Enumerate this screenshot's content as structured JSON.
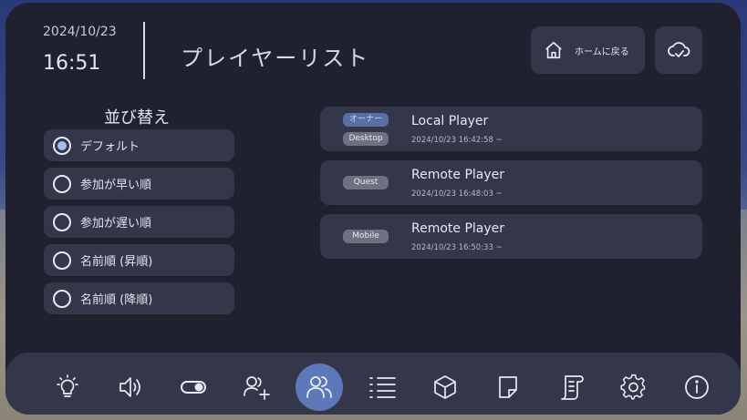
{
  "header": {
    "date": "2024/10/23",
    "time": "16:51",
    "title": "プレイヤーリスト",
    "home_label": "ホームに戻る",
    "home_icon": "home-icon",
    "cloud_icon": "cloud-check-icon"
  },
  "sort": {
    "title": "並び替え",
    "options": [
      {
        "label": "デフォルト",
        "selected": true
      },
      {
        "label": "参加が早い順",
        "selected": false
      },
      {
        "label": "参加が遅い順",
        "selected": false
      },
      {
        "label": "名前順 (昇順)",
        "selected": false
      },
      {
        "label": "名前順 (降順)",
        "selected": false
      }
    ]
  },
  "players": [
    {
      "badges": [
        "オーナー",
        "Desktop"
      ],
      "name": "Local Player",
      "joined": "2024/10/23 16:42:58 ~"
    },
    {
      "badges": [
        "Quest"
      ],
      "name": "Remote Player",
      "joined": "2024/10/23 16:48:03 ~"
    },
    {
      "badges": [
        "Mobile"
      ],
      "name": "Remote Player",
      "joined": "2024/10/23 16:50:33 ~"
    }
  ],
  "dock": {
    "items": [
      "lightbulb-icon",
      "speaker-icon",
      "toggle-icon",
      "add-user-icon",
      "users-icon",
      "list-icon",
      "cube-icon",
      "note-icon",
      "scroll-icon",
      "gear-icon",
      "info-icon"
    ],
    "active": "users-icon"
  },
  "colors": {
    "panel": "#20212e",
    "card": "#34364a",
    "accent": "#5d78b8",
    "owner_badge": "#5a6fa6"
  }
}
